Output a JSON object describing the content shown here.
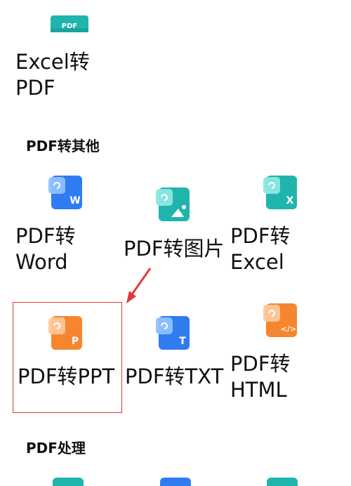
{
  "top_partial": {
    "icon_badge": "PDF",
    "label_line1": "Excel转",
    "label_line2": "PDF"
  },
  "sections": {
    "convert_title": "PDF转其他",
    "process_title": "PDF处理"
  },
  "tools": {
    "word": {
      "line1": "PDF转",
      "line2": "Word",
      "badge": "W"
    },
    "image": {
      "line1": "PDF转图片"
    },
    "excel": {
      "line1": "PDF转",
      "line2": "Excel",
      "badge": "X"
    },
    "ppt": {
      "line1": "PDF转PPT",
      "badge": "P"
    },
    "txt": {
      "line1": "PDF转TXT",
      "badge": "T"
    },
    "html": {
      "line1": "PDF转",
      "line2": "HTML",
      "badge": "</>"
    }
  },
  "colors": {
    "teal": "#1fb5ad",
    "blue": "#2f7cf0",
    "orange": "#f5862f",
    "annotation_red": "#e23a3a"
  }
}
